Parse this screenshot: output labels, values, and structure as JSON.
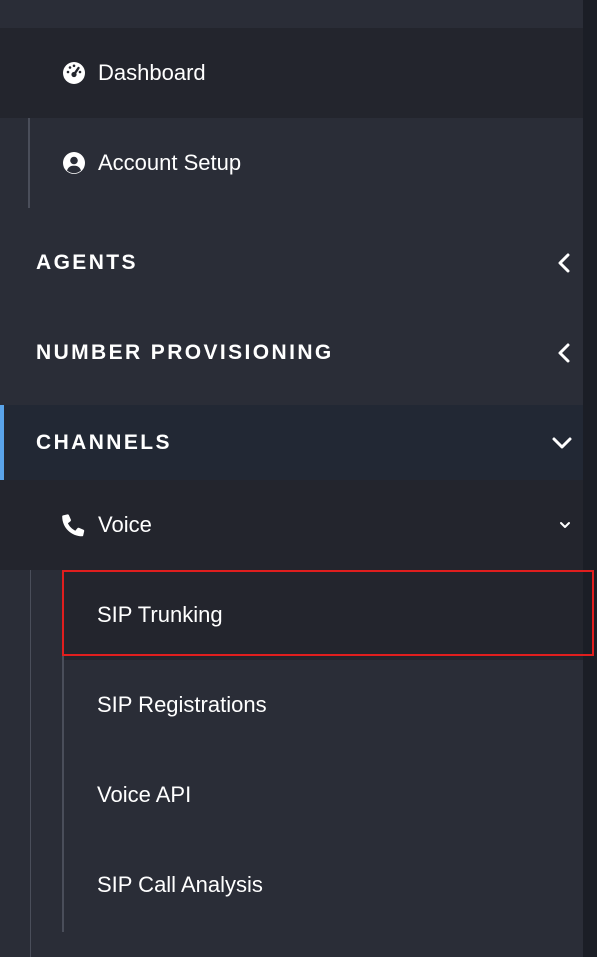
{
  "nav": {
    "dashboard": {
      "label": "Dashboard",
      "icon": "gauge-icon"
    },
    "account_setup": {
      "label": "Account Setup",
      "icon": "user-circle-icon"
    },
    "sections": [
      {
        "label": "AGENTS",
        "state": "collapsed",
        "icon": "chevron-left-icon"
      },
      {
        "label": "NUMBER PROVISIONING",
        "state": "collapsed",
        "icon": "chevron-left-icon"
      },
      {
        "label": "CHANNELS",
        "state": "expanded",
        "icon": "chevron-down-icon"
      }
    ],
    "voice": {
      "label": "Voice",
      "icon": "phone-icon",
      "items": [
        {
          "label": "SIP Trunking",
          "active": true
        },
        {
          "label": "SIP Registrations"
        },
        {
          "label": "Voice API"
        },
        {
          "label": "SIP Call Analysis"
        }
      ]
    }
  },
  "colors": {
    "background": "#2a2d37",
    "active_row": "#23252d",
    "section_active": "#222834",
    "accent": "#5aa4ea",
    "highlight": "#e01e1e"
  }
}
